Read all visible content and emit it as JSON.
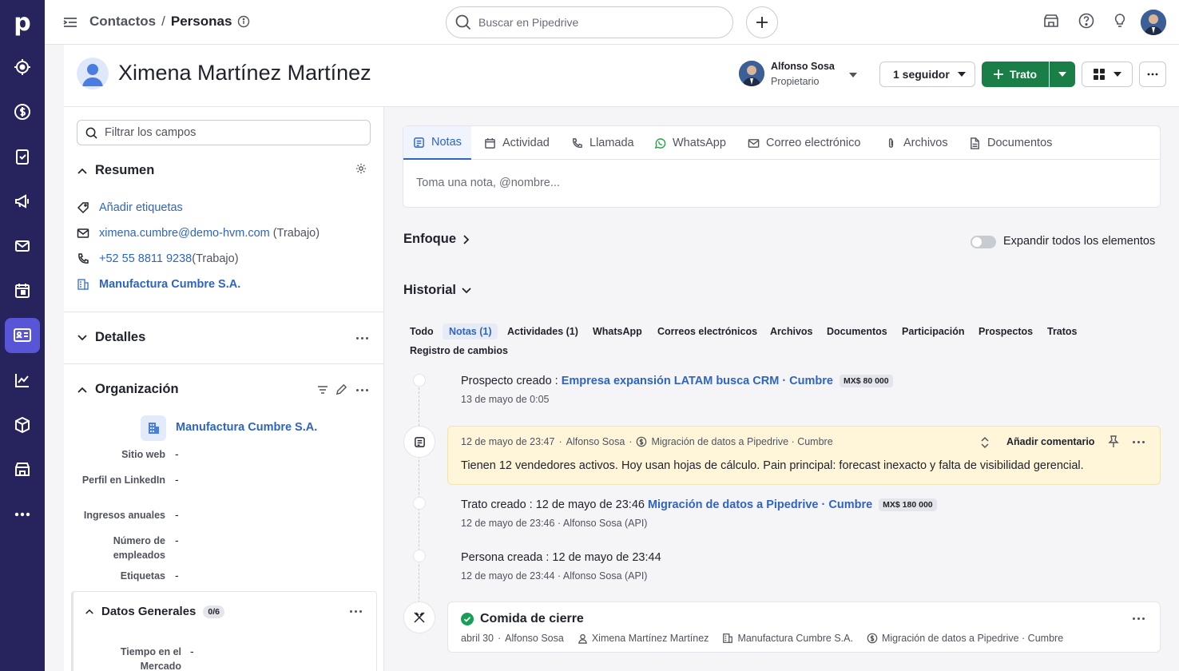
{
  "app": {
    "logo": "p"
  },
  "nav": {
    "items": [
      {
        "icon": "target-icon"
      },
      {
        "icon": "dollar-icon"
      },
      {
        "icon": "clipboard-check-icon"
      },
      {
        "icon": "megaphone-icon"
      },
      {
        "icon": "mail-icon"
      },
      {
        "icon": "calendar-icon"
      },
      {
        "icon": "contact-card-icon",
        "active": true
      },
      {
        "icon": "chart-icon"
      },
      {
        "icon": "box-icon"
      },
      {
        "icon": "store-icon"
      },
      {
        "icon": "more-icon"
      }
    ]
  },
  "topbar": {
    "breadcrumb_parent": "Contactos",
    "breadcrumb_sep": "/",
    "breadcrumb_current": "Personas",
    "search_placeholder": "Buscar en Pipedrive"
  },
  "header": {
    "person_name": "Ximena Martínez Martínez",
    "owner_name": "Alfonso Sosa",
    "owner_role": "Propietario",
    "followers": "1 seguidor",
    "deal_button": "Trato"
  },
  "panel": {
    "filter_placeholder": "Filtrar los campos",
    "summary": {
      "title": "Resumen",
      "add_tags": "Añadir etiquetas",
      "email": "ximena.cumbre@demo-hvm.com",
      "email_type": "(Trabajo)",
      "phone": "+52 55 8811 9238",
      "phone_type": "(Trabajo)",
      "org": "Manufactura Cumbre S.A."
    },
    "details_title": "Detalles",
    "organization": {
      "title": "Organización",
      "name": "Manufactura Cumbre S.A.",
      "fields": [
        {
          "label": "Sitio web",
          "value": "-"
        },
        {
          "label": "Perfil en LinkedIn",
          "value": "-"
        },
        {
          "label": "Ingresos anuales",
          "value": "-"
        },
        {
          "label": "Número de empleados",
          "value": "-"
        },
        {
          "label": "Etiquetas",
          "value": "-"
        }
      ]
    },
    "general": {
      "title": "Datos Generales",
      "badge": "0/6",
      "field_label": "Tiempo en el Mercado",
      "field_value": "-"
    }
  },
  "composer": {
    "tabs": [
      "Notas",
      "Actividad",
      "Llamada",
      "WhatsApp",
      "Correo electrónico",
      "Archivos",
      "Documentos"
    ],
    "placeholder": "Toma una nota, @nombre..."
  },
  "focus": {
    "title": "Enfoque",
    "expand_label": "Expandir todos los elementos"
  },
  "history": {
    "title": "Historial",
    "tabs": [
      "Todo",
      "Notas (1)",
      "Actividades (1)",
      "WhatsApp",
      "Correos electrónicos",
      "Archivos",
      "Documentos",
      "Participación",
      "Prospectos",
      "Tratos",
      "Registro de cambios"
    ],
    "events": {
      "lead": {
        "label": "Prospecto creado",
        "link": "Empresa expansión LATAM busca CRM · Cumbre",
        "amount": "MX$ 80 000",
        "meta": "13 de mayo de 0:05"
      },
      "note": {
        "date": "12 de mayo de 23:47",
        "author": "Alfonso Sosa",
        "deal": "Migración de datos a Pipedrive · Cumbre",
        "comment_action": "Añadir comentario",
        "text": "Tienen 12 vendedores activos. Hoy usan hojas de cálculo. Pain principal: forecast inexacto y falta de visibilidad gerencial."
      },
      "deal": {
        "label": "Trato creado",
        "date": "12 de mayo de 23:46",
        "link": "Migración de datos a Pipedrive · Cumbre",
        "amount": "MX$ 180 000",
        "meta": "12 de mayo de 23:46 · Alfonso Sosa (API)"
      },
      "person": {
        "label": "Persona creada",
        "date": "12 de mayo de 23:44",
        "meta": "12 de mayo de 23:44 · Alfonso Sosa (API)"
      },
      "activity": {
        "title": "Comida de cierre",
        "date": "abril 30",
        "owner": "Alfonso Sosa",
        "person": "Ximena Martínez Martínez",
        "org": "Manufactura Cumbre S.A.",
        "deal": "Migración de datos a Pipedrive · Cumbre"
      }
    }
  },
  "colors": {
    "nav_bg": "#26235d",
    "nav_active": "#5856d6",
    "link": "#2e64c4",
    "primary_green": "#1a7f47",
    "note_bg": "#fff6d9"
  }
}
